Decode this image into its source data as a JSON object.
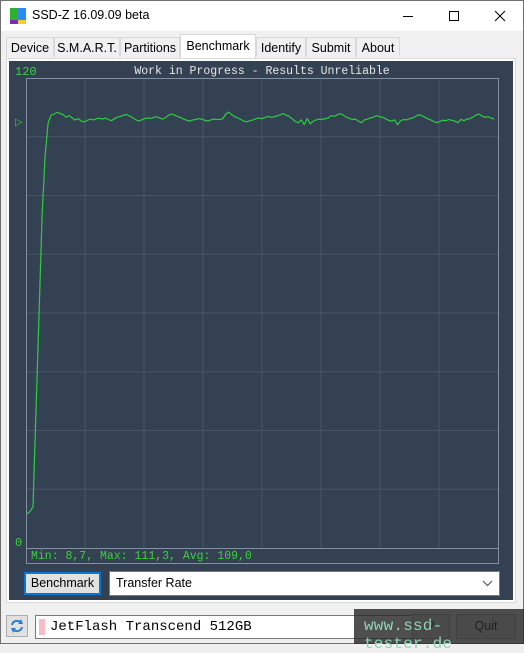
{
  "window": {
    "title": "SSD-Z 16.09.09 beta",
    "controls": {
      "minimize": "—",
      "maximize": "☐",
      "close": "✕"
    }
  },
  "tabs": [
    {
      "label": "Device",
      "active": false
    },
    {
      "label": "S.M.A.R.T.",
      "active": false
    },
    {
      "label": "Partitions",
      "active": false
    },
    {
      "label": "Benchmark",
      "active": true
    },
    {
      "label": "Identify",
      "active": false
    },
    {
      "label": "Submit",
      "active": false
    },
    {
      "label": "About",
      "active": false
    }
  ],
  "benchmark": {
    "button_label": "Benchmark",
    "mode_select": {
      "value": "Transfer Rate"
    }
  },
  "footer": {
    "drive_name": "JetFlash Transcend 512GB",
    "help_label": "?",
    "quit_label": "Quit",
    "watermark": "www.ssd-tester.de"
  },
  "colors": {
    "chart_bg": "#334152",
    "grid": "#46566a",
    "axis": "#8391a3",
    "series": "#2ecc40",
    "label_green": "#3ad23a",
    "title_text": "#e6e6e6",
    "accent": "#0078d7"
  },
  "chart_data": {
    "type": "line",
    "title": "Work in Progress - Results Unreliable",
    "xlabel": "",
    "ylabel": "",
    "y_tick_labels": {
      "top": "120",
      "bottom": "0"
    },
    "ylim": [
      0,
      120
    ],
    "grid": true,
    "avg_marker": "▷",
    "stats_text": "Min: 8,7, Max: 111,3, Avg: 109,0",
    "stats": {
      "min": 8.7,
      "max": 111.3,
      "avg": 109.0
    },
    "series": [
      {
        "name": "Transfer Rate",
        "values": [
          8.7,
          9.3,
          10.5,
          35,
          60,
          85,
          100,
          108.5,
          110.5,
          110.8,
          111.2,
          111.0,
          110.6,
          110.0,
          110.4,
          109.8,
          109.3,
          109.6,
          109.0,
          108.8,
          109.2,
          109.5,
          109.3,
          109.6,
          109.7,
          109.5,
          109.8,
          109.4,
          109.1,
          109.6,
          110.0,
          110.2,
          110.5,
          110.7,
          110.3,
          109.9,
          109.4,
          109.0,
          109.3,
          109.6,
          109.8,
          109.7,
          109.9,
          110.1,
          109.8,
          109.5,
          109.9,
          110.5,
          110.8,
          110.5,
          110.2,
          109.9,
          109.5,
          109.2,
          109.0,
          109.3,
          109.4,
          109.6,
          109.5,
          109.2,
          109.0,
          109.3,
          109.5,
          109.4,
          109.4,
          109.6,
          110.8,
          111.3,
          110.6,
          110.1,
          109.8,
          109.4,
          109.0,
          108.8,
          109.1,
          109.3,
          109.6,
          109.8,
          109.6,
          109.9,
          110.2,
          110.0,
          110.1,
          110.3,
          110.6,
          110.9,
          110.5,
          110.2,
          109.6,
          108.9,
          108.6,
          109.3,
          108.1,
          109.6,
          108.3,
          109.0,
          109.3,
          109.5,
          109.4,
          109.6,
          109.8,
          110.4,
          110.2,
          110.6,
          110.9,
          110.5,
          110.0,
          109.7,
          109.4,
          109.5,
          109.0,
          108.6,
          109.3,
          109.5,
          109.8,
          110.0,
          110.4,
          110.1,
          110.0,
          109.6,
          109.2,
          109.0,
          109.3,
          108.1,
          109.1,
          109.4,
          109.3,
          109.6,
          109.8,
          110.2,
          110.6,
          110.4,
          110.0,
          109.6,
          109.3,
          108.9,
          108.6,
          108.9,
          109.2,
          109.1,
          109.4,
          109.2,
          109.0,
          108.6,
          109.4,
          109.1,
          109.5,
          109.6,
          110.0,
          110.5,
          110.8,
          110.3,
          110.0,
          110.1,
          109.8,
          109.5
        ]
      }
    ]
  }
}
